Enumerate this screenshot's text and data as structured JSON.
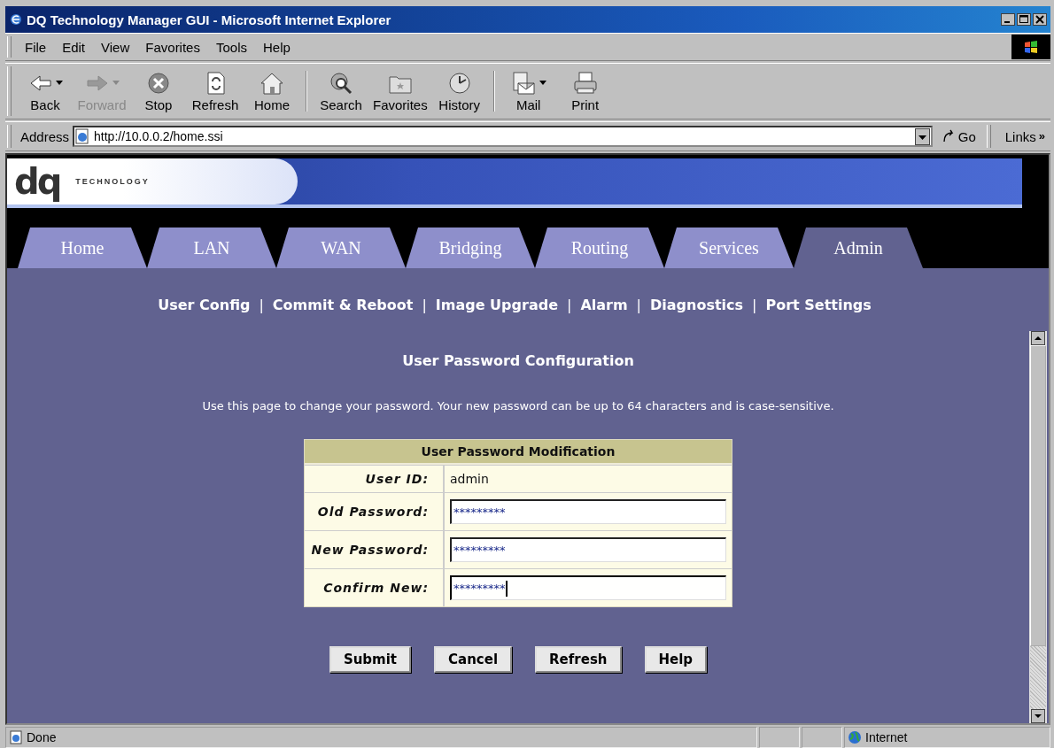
{
  "window": {
    "title": "DQ Technology Manager GUI - Microsoft Internet Explorer"
  },
  "menu": [
    "File",
    "Edit",
    "View",
    "Favorites",
    "Tools",
    "Help"
  ],
  "toolbar": [
    {
      "kind": "back",
      "label": "Back",
      "disabled": false,
      "dropdown": true
    },
    {
      "kind": "forward",
      "label": "Forward",
      "disabled": true,
      "dropdown": true
    },
    {
      "kind": "stop",
      "label": "Stop",
      "disabled": false,
      "dropdown": false
    },
    {
      "kind": "refresh",
      "label": "Refresh",
      "disabled": false,
      "dropdown": false
    },
    {
      "kind": "home",
      "label": "Home",
      "disabled": false,
      "dropdown": false
    },
    {
      "kind": "separator"
    },
    {
      "kind": "search",
      "label": "Search",
      "disabled": false,
      "dropdown": false
    },
    {
      "kind": "favorites",
      "label": "Favorites",
      "disabled": false,
      "dropdown": false
    },
    {
      "kind": "history",
      "label": "History",
      "disabled": false,
      "dropdown": false
    },
    {
      "kind": "separator"
    },
    {
      "kind": "mail",
      "label": "Mail",
      "disabled": false,
      "dropdown": true
    },
    {
      "kind": "print",
      "label": "Print",
      "disabled": false,
      "dropdown": false
    }
  ],
  "address": {
    "label": "Address",
    "url": "http://10.0.0.2/home.ssi",
    "go": "Go",
    "links": "Links",
    "more": "»"
  },
  "banner": {
    "logo": "dq",
    "tagline": "TECHNOLOGY"
  },
  "tabs": [
    {
      "label": "Home",
      "selected": false
    },
    {
      "label": "LAN",
      "selected": false
    },
    {
      "label": "WAN",
      "selected": false
    },
    {
      "label": "Bridging",
      "selected": false
    },
    {
      "label": "Routing",
      "selected": false
    },
    {
      "label": "Services",
      "selected": false
    },
    {
      "label": "Admin",
      "selected": true
    }
  ],
  "subnav": [
    {
      "kind": "link",
      "text": "User Config"
    },
    {
      "kind": "separator",
      "text": "|"
    },
    {
      "kind": "link",
      "text": "Commit & Reboot"
    },
    {
      "kind": "separator",
      "text": "|"
    },
    {
      "kind": "link",
      "text": "Image Upgrade"
    },
    {
      "kind": "separator",
      "text": "|"
    },
    {
      "kind": "link",
      "text": "Alarm"
    },
    {
      "kind": "separator",
      "text": "|"
    },
    {
      "kind": "link",
      "text": "Diagnostics"
    },
    {
      "kind": "separator",
      "text": "|"
    },
    {
      "kind": "link",
      "text": "Port Settings"
    }
  ],
  "heading": "User Password Configuration",
  "intro": "Use this page to change your password. Your new password can be up to 64 characters and is case-sensitive.",
  "form": {
    "title": "User Password Modification",
    "rows": [
      {
        "kind": "text",
        "label": "User ID:",
        "value": "admin"
      },
      {
        "kind": "input",
        "label": "Old Password:",
        "value": "*********",
        "focused": false
      },
      {
        "kind": "input",
        "label": "New Password:",
        "value": "*********",
        "focused": false
      },
      {
        "kind": "input",
        "label": "Confirm New:",
        "value": "*********",
        "focused": true
      }
    ]
  },
  "buttons": [
    "Submit",
    "Cancel",
    "Refresh",
    "Help"
  ],
  "status_bar": {
    "text": "Done",
    "zone": "Internet"
  }
}
